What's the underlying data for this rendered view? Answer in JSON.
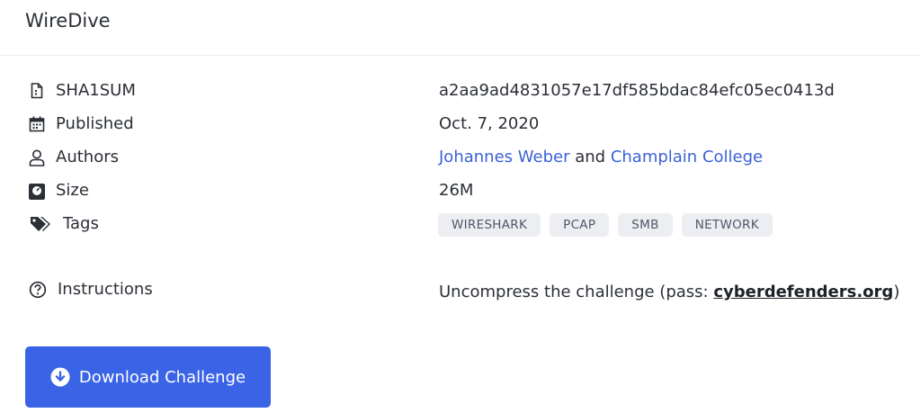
{
  "header": {
    "title": "WireDive"
  },
  "details": {
    "sha1": {
      "icon": "file-hash-icon",
      "label": "SHA1SUM",
      "value": "a2aa9ad4831057e17df585bdac84efc05ec0413d"
    },
    "published": {
      "icon": "calendar-icon",
      "label": "Published",
      "value": "Oct. 7, 2020"
    },
    "authors": {
      "icon": "user-icon",
      "label": "Authors",
      "author1": "Johannes Weber",
      "separator": "and",
      "author2": "Champlain College"
    },
    "size": {
      "icon": "scale-icon",
      "label": "Size",
      "value": "26M"
    },
    "tags": {
      "icon": "tags-icon",
      "label": "Tags",
      "items": [
        "WIRESHARK",
        "PCAP",
        "SMB",
        "NETWORK"
      ]
    },
    "instructions": {
      "icon": "question-circle-icon",
      "label": "Instructions",
      "prefix": "Uncompress the challenge (pass: ",
      "password": "cyberdefenders.org",
      "suffix": ")"
    }
  },
  "download": {
    "label": "Download Challenge",
    "icon": "download-circle-icon"
  },
  "colors": {
    "accent": "#3a63e6",
    "link": "#3b62d6",
    "tag_bg": "#eceef2"
  }
}
